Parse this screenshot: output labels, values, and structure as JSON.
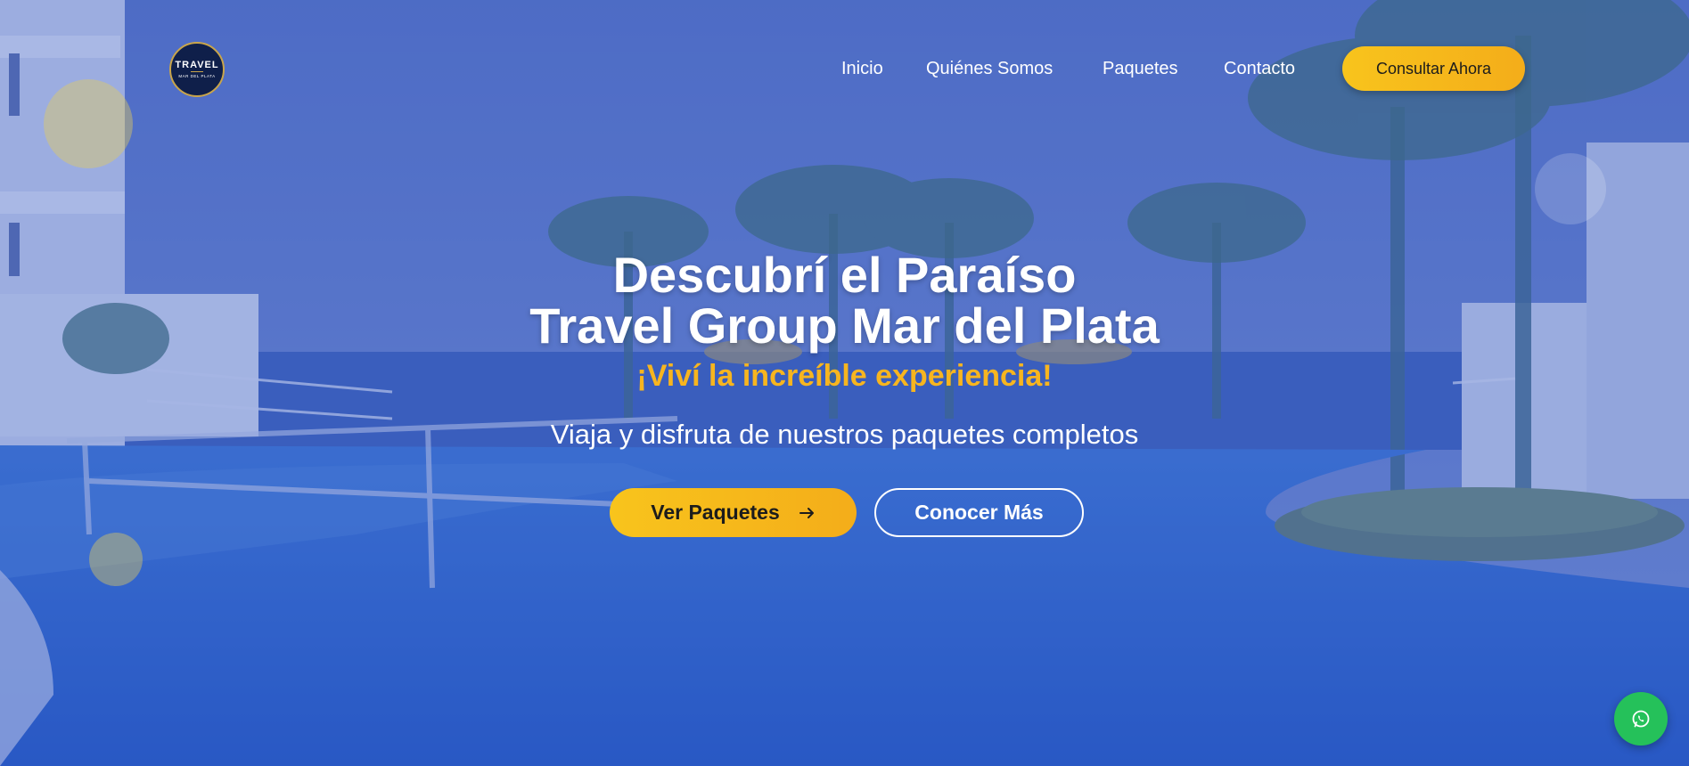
{
  "brand": {
    "logo_line1": "TRAVEL",
    "logo_line2": "MAR DEL PLATA"
  },
  "nav": {
    "items": [
      {
        "label": "Inicio"
      },
      {
        "label": "Quiénes Somos"
      },
      {
        "label": "Paquetes"
      },
      {
        "label": "Contacto"
      }
    ],
    "cta_label": "Consultar Ahora"
  },
  "hero": {
    "title_line1": "Descubrí el Paraíso",
    "title_line2": "Travel Group Mar del Plata",
    "tagline": "¡Viví la increíble experiencia!",
    "subtitle": "Viaja y disfruta de nuestros paquetes completos",
    "primary_button": "Ver Paquetes",
    "primary_button_icon": "arrow-right-icon",
    "secondary_button": "Conocer Más"
  },
  "floating": {
    "whatsapp_icon": "whatsapp-icon"
  },
  "colors": {
    "accent": "#F7B51F",
    "overlay": "#3A5CC4",
    "whatsapp": "#25C15A",
    "logo_bg": "#0F1F4A"
  }
}
